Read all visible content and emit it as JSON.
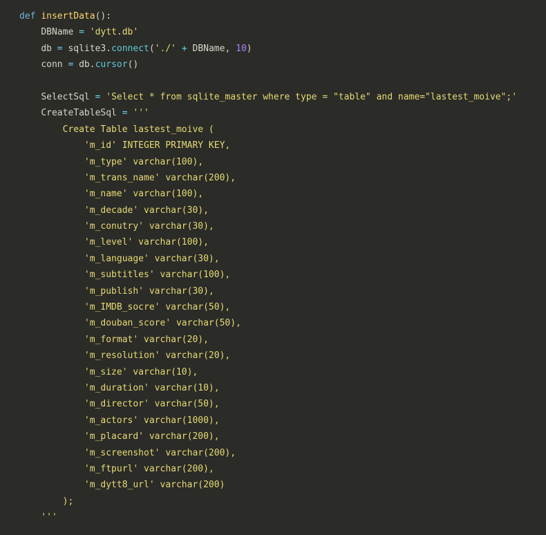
{
  "code": {
    "line1": {
      "kw": "def",
      "fn": "insertData",
      "paren_open": "(",
      "paren_close": ")",
      "colon": ":"
    },
    "line2": {
      "lhs": "DBName",
      "op": "=",
      "str": "'dytt.db'"
    },
    "line3": {
      "lhs": "db",
      "op": "=",
      "obj": "sqlite3",
      "dot": ".",
      "call": "connect",
      "paren_open": "(",
      "arg_str": "'./'",
      "plus": "+",
      "arg_id": "DBName",
      "comma": ",",
      "arg_num": "10",
      "paren_close": ")"
    },
    "line4": {
      "lhs": "conn",
      "op": "=",
      "obj": "db",
      "dot": ".",
      "call": "cursor",
      "paren_open": "(",
      "paren_close": ")"
    },
    "line6": {
      "lhs": "SelectSql",
      "op": "=",
      "str": "'Select * from sqlite_master where type = \"table\" and name=\"lastest_moive\";'"
    },
    "line7": {
      "lhs": "CreateTableSql",
      "op": "=",
      "str_open": "'''"
    },
    "sql": {
      "l1": "        Create Table lastest_moive (",
      "l2": "            'm_id' INTEGER PRIMARY KEY,",
      "l3": "            'm_type' varchar(100),",
      "l4": "            'm_trans_name' varchar(200),",
      "l5": "            'm_name' varchar(100),",
      "l6": "            'm_decade' varchar(30),",
      "l7": "            'm_conutry' varchar(30),",
      "l8": "            'm_level' varchar(100),",
      "l9": "            'm_language' varchar(30),",
      "l10": "            'm_subtitles' varchar(100),",
      "l11": "            'm_publish' varchar(30),",
      "l12": "            'm_IMDB_socre' varchar(50),",
      "l13": "            'm_douban_score' varchar(50),",
      "l14": "            'm_format' varchar(20),",
      "l15": "            'm_resolution' varchar(20),",
      "l16": "            'm_size' varchar(10),",
      "l17": "            'm_duration' varchar(10),",
      "l18": "            'm_director' varchar(50),",
      "l19": "            'm_actors' varchar(1000),",
      "l20": "            'm_placard' varchar(200),",
      "l21": "            'm_screenshot' varchar(200),",
      "l22": "            'm_ftpurl' varchar(200),",
      "l23": "            'm_dytt8_url' varchar(200)",
      "l24": "        );",
      "close": "    '''"
    }
  }
}
